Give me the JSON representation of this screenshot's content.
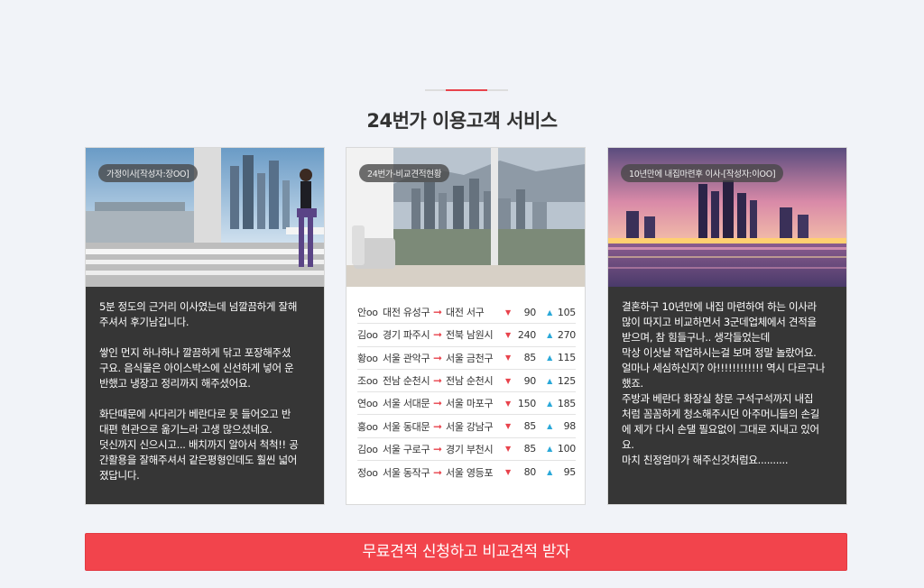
{
  "section": {
    "title": "24번가 이용고객 서비스"
  },
  "cards": [
    {
      "tag": "가정이사[작성자:장OO]",
      "review": "5분 정도의 근거리 이사였는데 넘깔끔하게 잘해\n주셔서 후기남깁니다.\n\n쌓인 먼지 하나하나 깔끔하게 닦고 포장해주셨\n구요. 음식물은 아이스박스에 신선하게 넣어 운\n반했고 냉장고 정리까지 해주셨어요.\n\n화단때문에 사다리가 베란다로 못 들어오고 반\n대편 현관으로 옮기느라 고생 많으셨네요.\n덧신까지 신으시고... 배치까지 알아서 척척!! 공\n간활용을 잘해주셔서 같은평형인데도 훨씬 넓어\n졌답니다."
    },
    {
      "tag": "24번가-비교견적현황",
      "rows": [
        {
          "name": "안oo",
          "from": "대전 유성구",
          "to": "대전 서구",
          "down": "90",
          "up": "105"
        },
        {
          "name": "김oo",
          "from": "경기 파주시",
          "to": "전북 남원시",
          "down": "240",
          "up": "270"
        },
        {
          "name": "황oo",
          "from": "서울 관악구",
          "to": "서울 금천구",
          "down": "85",
          "up": "115"
        },
        {
          "name": "조oo",
          "from": "전남 순천시",
          "to": "전남 순천시",
          "down": "90",
          "up": "125"
        },
        {
          "name": "연oo",
          "from": "서울 서대문",
          "to": "서울 마포구",
          "down": "150",
          "up": "185"
        },
        {
          "name": "홍oo",
          "from": "서울 동대문",
          "to": "서울 강남구",
          "down": "85",
          "up": "98"
        },
        {
          "name": "김oo",
          "from": "서울 구로구",
          "to": "경기 부천시",
          "down": "85",
          "up": "100"
        },
        {
          "name": "정oo",
          "from": "서울 동작구",
          "to": "서울 영등포",
          "down": "80",
          "up": "95"
        }
      ]
    },
    {
      "tag": "10년만에 내집마련후 이사-[작성자:이OO]",
      "review": "결혼하구 10년만에 내집 마련하여 하는 이사라\n많이 따지고 비교하면서 3군데업체에서 견적을\n받으며, 참 힘들구나.. 생각들었는데\n막상 이삿날 작업하시는걸 보며 정말 놀랐어요.\n얼마나 세심하신지? 아!!!!!!!!!!!! 역시 다르구나\n했죠.\n주방과 베란다 화장실 창문 구석구석까지 내집\n처럼 꼼꼼하게 청소해주시던 아주머니들의 손길\n에 제가 다시 손댈 필요없이 그대로 지내고 있어\n요.\n마치 친정엄마가 해주신것처럼요.........."
    }
  ],
  "icons": {
    "arrow": "red-right-arrow-icon",
    "down": "red-down-triangle-icon",
    "up": "blue-up-triangle-icon"
  },
  "cta": {
    "label": "무료견적 신청하고 비교견적 받자"
  },
  "colors": {
    "accent": "#f2444c",
    "up": "#2aa8d8",
    "dark": "#363636",
    "background": "#f1f3f8"
  }
}
